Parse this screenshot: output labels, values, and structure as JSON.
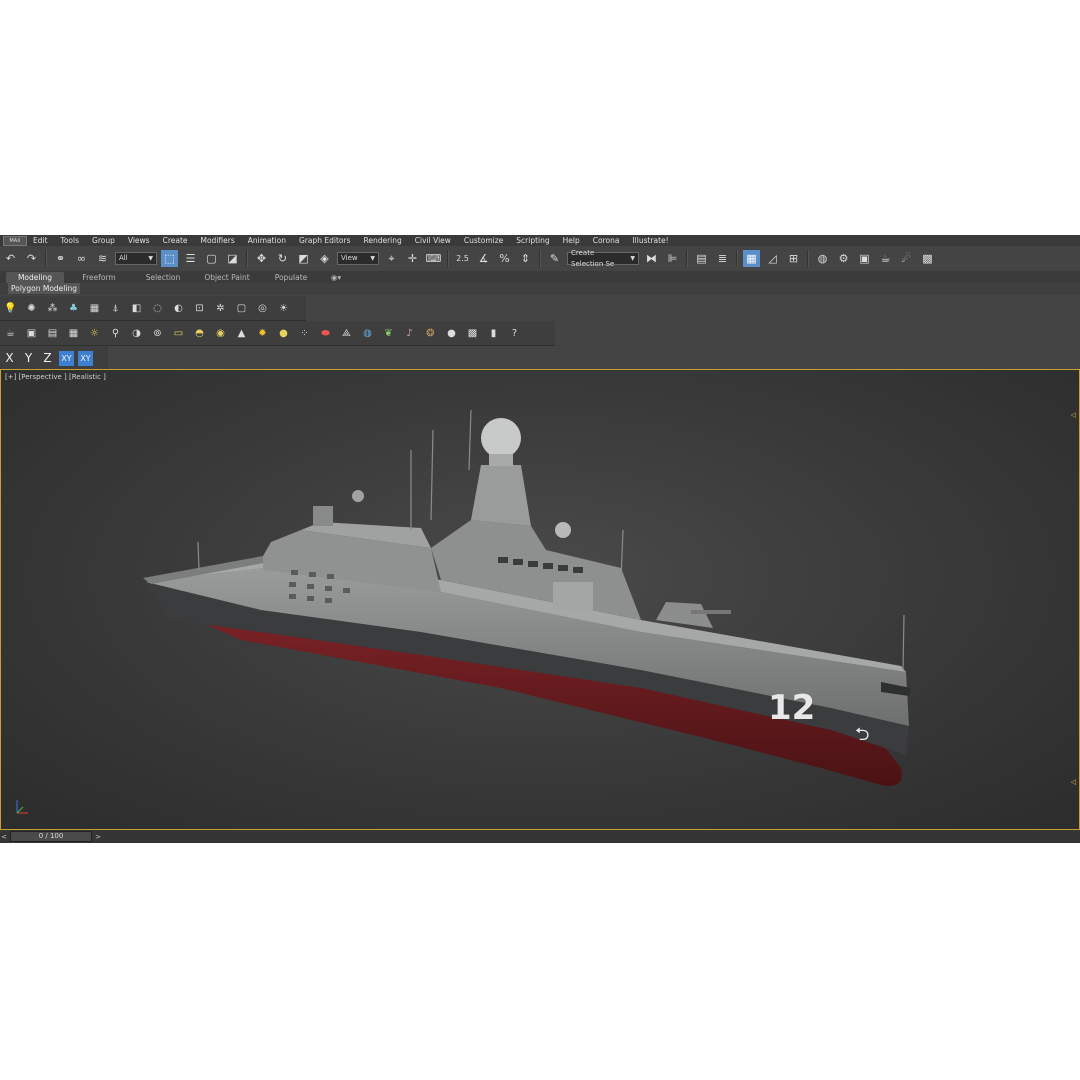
{
  "menubar": {
    "logo": "MAX",
    "items": [
      "Edit",
      "Tools",
      "Group",
      "Views",
      "Create",
      "Modifiers",
      "Animation",
      "Graph Editors",
      "Rendering",
      "Civil View",
      "Customize",
      "Scripting",
      "Help",
      "Corona",
      "Illustrate!"
    ]
  },
  "toolbar": {
    "selection_filter": "All",
    "ref_coord": "View",
    "snap_label": "2.5",
    "named_selection": "Create Selection Se"
  },
  "ribbon": {
    "tabs": [
      "Modeling",
      "Freeform",
      "Selection",
      "Object Paint",
      "Populate"
    ],
    "active_tab": "Modeling",
    "sub_label": "Polygon Modeling"
  },
  "axis_constraints": {
    "x": "X",
    "y": "Y",
    "z": "Z",
    "xy": "XY",
    "xy2": "XY"
  },
  "viewport": {
    "label": "[+] [Perspective ] [Realistic ]",
    "hull_number": "12"
  },
  "timeline": {
    "frame": "0 / 100",
    "prev": "<",
    "next": ">"
  },
  "colors": {
    "accent_blue": "#5a8fc8",
    "viewport_border": "#c8a030",
    "hull_grey": "#8c8e8e",
    "hull_red": "#6a1a1c"
  }
}
